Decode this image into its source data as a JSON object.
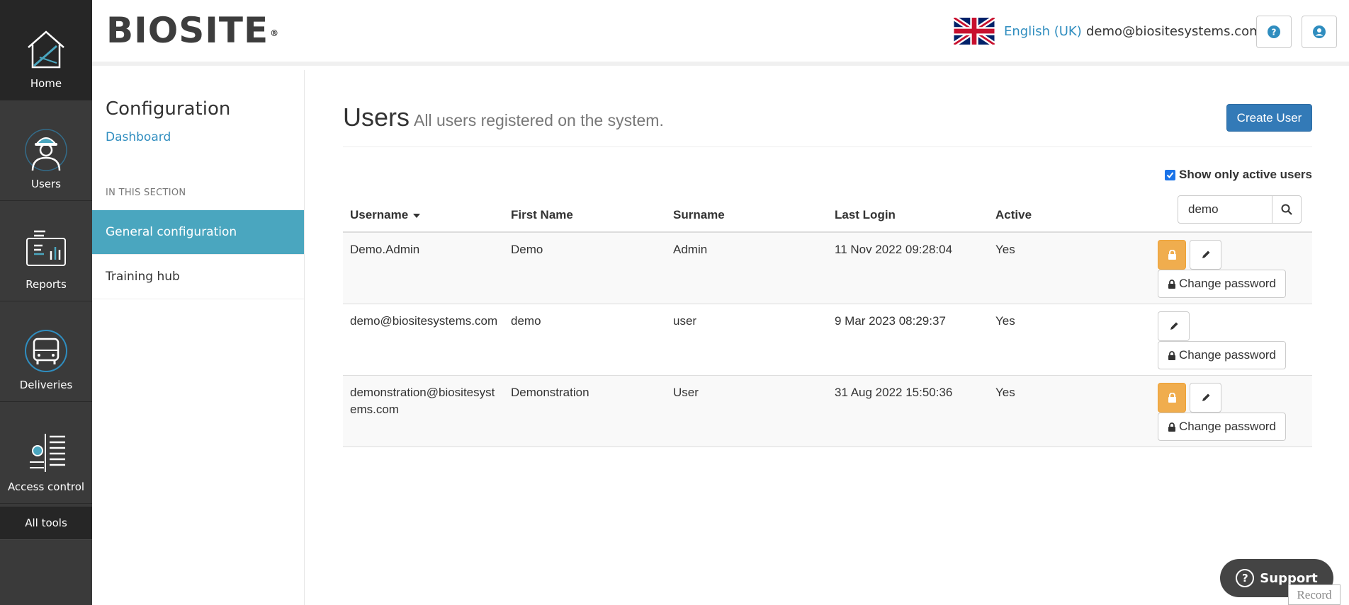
{
  "rail": {
    "items": [
      {
        "label": "Home",
        "icon": "house-icon"
      },
      {
        "label": "Users",
        "icon": "worker-icon"
      },
      {
        "label": "Reports",
        "icon": "reports-icon"
      },
      {
        "label": "Deliveries",
        "icon": "truck-icon"
      },
      {
        "label": "Access control",
        "icon": "turnstile-icon"
      }
    ],
    "all_tools": "All tools"
  },
  "header": {
    "logo": "BIOSITE",
    "logo_mark": "®",
    "language": "English (UK)",
    "email": "demo@biositesystems.com"
  },
  "sidebar": {
    "title": "Configuration",
    "dashboard_link": "Dashboard",
    "section_label": "IN THIS SECTION",
    "items": [
      {
        "label": "General configuration",
        "active": true
      },
      {
        "label": "Training hub",
        "active": false
      }
    ]
  },
  "main": {
    "title": "Users",
    "subtitle": "All users registered on the system.",
    "create_button": "Create User",
    "show_active_label": "Show only active users",
    "show_active_checked": true,
    "search_value": "demo",
    "columns": [
      "Username",
      "First Name",
      "Surname",
      "Last Login",
      "Active"
    ],
    "change_password_label": "Change password",
    "rows": [
      {
        "username": "Demo.Admin",
        "first_name": "Demo",
        "surname": "Admin",
        "last_login": "11 Nov 2022 09:28:04",
        "active": "Yes",
        "locked": true
      },
      {
        "username": "demo@biositesystems.com",
        "first_name": "demo",
        "surname": "user",
        "last_login": "9 Mar 2023 08:29:37",
        "active": "Yes",
        "locked": false
      },
      {
        "username": "demonstration@biositesystems.com",
        "username_line1": "demonstration@biositesyst",
        "username_line2": "ems.com",
        "first_name": "Demonstration",
        "surname": "User",
        "last_login": "31 Aug 2022 15:50:36",
        "active": "Yes",
        "locked": true
      }
    ]
  },
  "support": {
    "label": "Support",
    "record": "Record"
  },
  "colors": {
    "rail": "#3a3a3a",
    "accent": "#337ab7",
    "active_nav": "#4aa6bf",
    "warning": "#f0ad4e",
    "link": "#2f8dbf"
  }
}
